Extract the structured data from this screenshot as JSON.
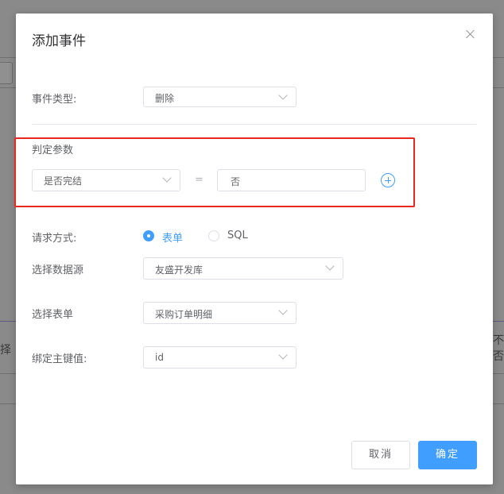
{
  "dialog": {
    "title": "添加事件",
    "event_type": {
      "label": "事件类型:",
      "value": "删除"
    },
    "judge": {
      "label": "判定参数",
      "param_value": "是否完结",
      "operator": "=",
      "compare_value": "否"
    },
    "request": {
      "label": "请求方式:",
      "options": [
        {
          "label": "表单",
          "selected": true
        },
        {
          "label": "SQL",
          "selected": false
        }
      ]
    },
    "datasource": {
      "label": "选择数据源",
      "value": "友盛开发库"
    },
    "form": {
      "label": "选择表单",
      "value": "采购订单明细"
    },
    "primary_key": {
      "label": "绑定主键值:",
      "value": "id"
    },
    "buttons": {
      "cancel": "取消",
      "ok": "确定"
    }
  },
  "background": {
    "left_text": "择",
    "right_text": "不否"
  },
  "colors": {
    "primary": "#409eff",
    "highlight": "#e8281e",
    "text": "#606266"
  }
}
